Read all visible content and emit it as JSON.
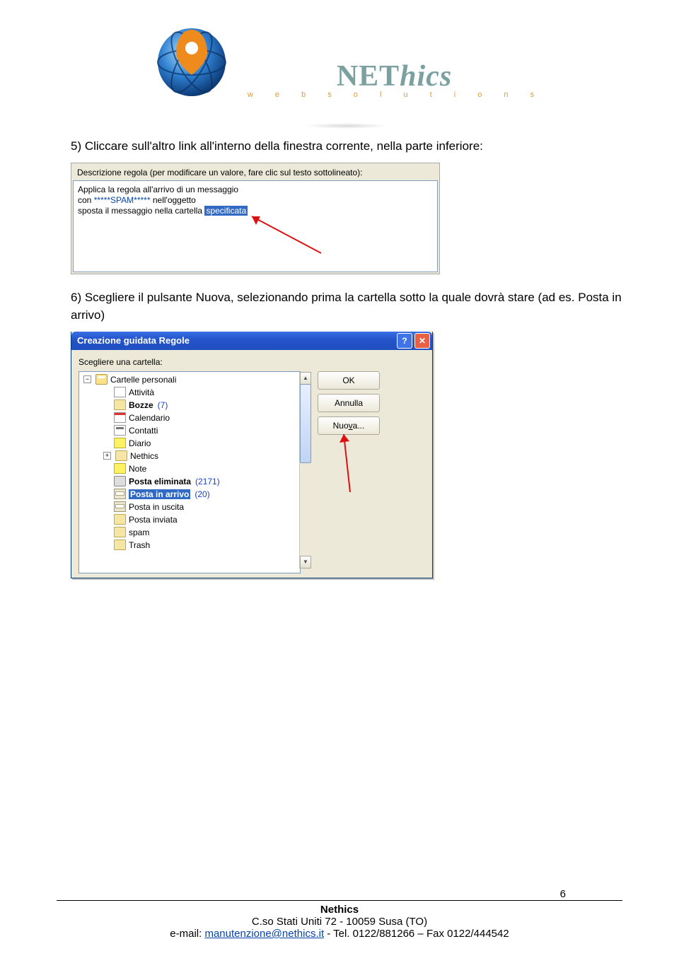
{
  "header": {
    "brand_name": "NEThics",
    "brand_sub": "w e b   s o l u t i o n s"
  },
  "step5": {
    "text": "5) Cliccare sull'altro link all'interno della finestra corrente, nella parte inferiore:"
  },
  "ss1": {
    "label": "Descrizione regola (per modificare un valore, fare clic sul testo sottolineato):",
    "line1": "Applica la regola all'arrivo di un messaggio",
    "line2_pre": "con ",
    "line2_link": "*****SPAM*****",
    "line2_post": " nell'oggetto",
    "line3_pre": "sposta il messaggio nella cartella ",
    "line3_link": "specificata"
  },
  "step6": {
    "text": "6) Scegliere il pulsante Nuova, selezionando prima la cartella sotto la quale dovrà stare (ad es. Posta in arrivo)"
  },
  "ss2": {
    "title": "Creazione guidata Regole",
    "instr": "Scegliere una cartella:",
    "buttons": {
      "ok": "OK",
      "cancel": "Annulla",
      "new": "Nuova..."
    },
    "tree": [
      {
        "lvl": 1,
        "expander": "minus",
        "icon": "root",
        "label": "Cartelle personali",
        "bold": false
      },
      {
        "lvl": 2,
        "expander": "",
        "icon": "task",
        "label": "Attività"
      },
      {
        "lvl": 2,
        "expander": "",
        "icon": "folder",
        "label": "Bozze",
        "bold": true,
        "count": "(7)"
      },
      {
        "lvl": 2,
        "expander": "",
        "icon": "cal",
        "label": "Calendario"
      },
      {
        "lvl": 2,
        "expander": "",
        "icon": "contacts",
        "label": "Contatti"
      },
      {
        "lvl": 2,
        "expander": "",
        "icon": "note",
        "label": "Diario"
      },
      {
        "lvl": 2,
        "expander": "plus",
        "icon": "folder",
        "label": "Nethics"
      },
      {
        "lvl": 2,
        "expander": "",
        "icon": "note",
        "label": "Note"
      },
      {
        "lvl": 2,
        "expander": "",
        "icon": "trash",
        "label": "Posta eliminata",
        "bold": true,
        "count": "(2171)"
      },
      {
        "lvl": 2,
        "expander": "",
        "icon": "inbox",
        "label": "Posta in arrivo",
        "bold": true,
        "selected": true,
        "count": "(20)"
      },
      {
        "lvl": 2,
        "expander": "",
        "icon": "inbox",
        "label": "Posta in uscita"
      },
      {
        "lvl": 2,
        "expander": "",
        "icon": "folder",
        "label": "Posta inviata"
      },
      {
        "lvl": 2,
        "expander": "",
        "icon": "folder",
        "label": "spam"
      },
      {
        "lvl": 2,
        "expander": "",
        "icon": "folder",
        "label": "Trash"
      }
    ]
  },
  "footer": {
    "company": "Nethics",
    "address": "C.so Stati Uniti 72 - 10059 Susa (TO)",
    "email_label": "e-mail: ",
    "email": "manutenzione@nethics.it",
    "phones": "   -   Tel. 0122/881266 – Fax 0122/444542",
    "page": "6"
  }
}
